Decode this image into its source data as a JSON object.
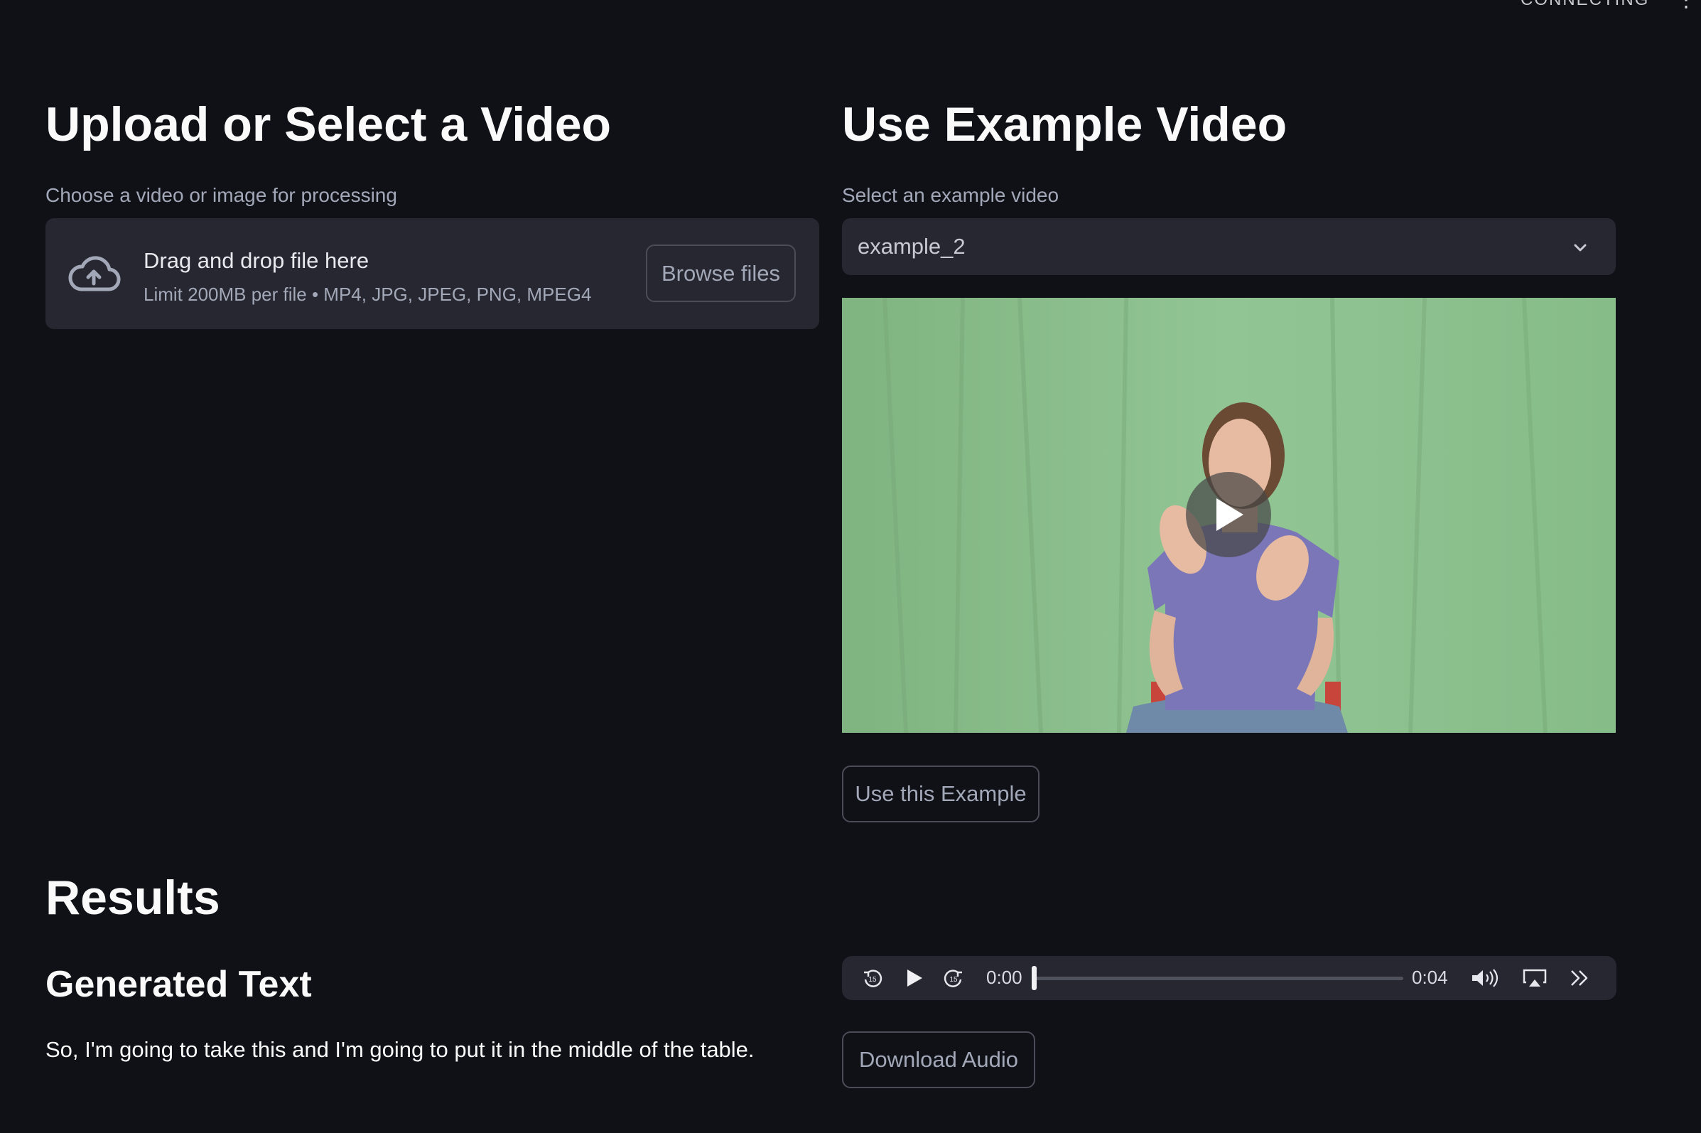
{
  "header": {
    "status_text": "CONNECTING",
    "menu_glyph": "⋮"
  },
  "left": {
    "heading": "Upload or Select a Video",
    "uploader": {
      "label": "Choose a video or image for processing",
      "title": "Drag and drop file here",
      "limit": "Limit 200MB per file • MP4, JPG, JPEG, PNG, MPEG4",
      "browse_label": "Browse files",
      "icon": "cloud-upload-icon"
    }
  },
  "right": {
    "heading": "Use Example Video",
    "select": {
      "label": "Select an example video",
      "value": "example_2",
      "icon": "chevron-down-icon"
    },
    "video": {
      "overlay_icon": "play-icon"
    },
    "use_example_label": "Use this Example"
  },
  "results": {
    "heading": "Results",
    "subheading": "Generated Text",
    "text": "So, I'm going to take this and I'm going to put it in the middle of the table."
  },
  "audio": {
    "current_time": "0:00",
    "duration": "0:04",
    "progress": 0,
    "icons": [
      "rewind-15-icon",
      "play-icon",
      "forward-15-icon",
      "volume-icon",
      "airplay-icon",
      "more-icon"
    ]
  },
  "download_label": "Download Audio",
  "colors": {
    "background": "#0f1117",
    "widget": "#262730",
    "text": "#fafafa",
    "muted": "#a3a8b8"
  }
}
